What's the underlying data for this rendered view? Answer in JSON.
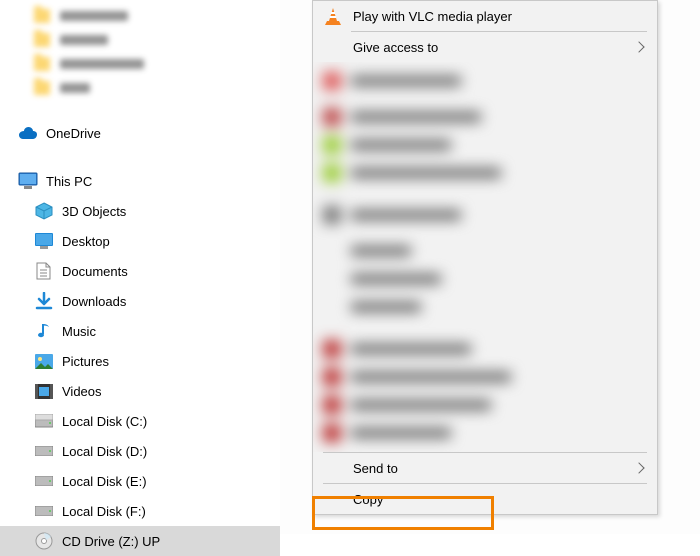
{
  "sidebar": {
    "onedrive": "OneDrive",
    "thispc": "This PC",
    "items": [
      "3D Objects",
      "Desktop",
      "Documents",
      "Downloads",
      "Music",
      "Pictures",
      "Videos",
      "Local Disk (C:)",
      "Local Disk (D:)",
      "Local Disk (E:)",
      "Local Disk (F:)",
      "CD Drive (Z:) UP"
    ]
  },
  "menu": {
    "vlc": "Play with VLC media player",
    "give_access": "Give access to",
    "send_to": "Send to",
    "copy": "Copy"
  }
}
